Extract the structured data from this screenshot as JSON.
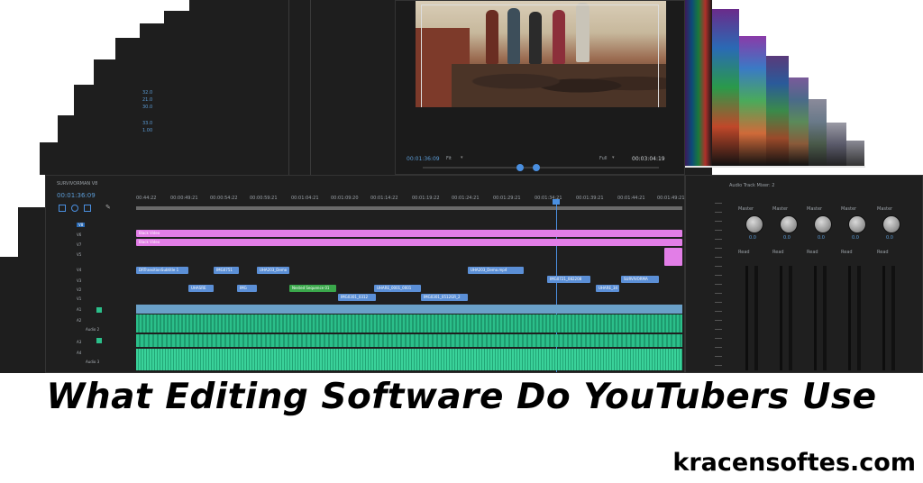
{
  "headline": "What Editing Software Do YouTubers Use",
  "site": "kracensoftes.com",
  "program_monitor": {
    "timecode_in": "00:01:36:09",
    "fit": "Fit",
    "quality": "Full",
    "timecode_out": "00:03:04:19"
  },
  "timeline": {
    "sequence_name": "SURVIVORMAN V8",
    "playhead_time": "00:01:36:09",
    "ruler": [
      "00:44:22",
      "00:00:49:21",
      "00:00:54:22",
      "00:00:59:21",
      "00:01:04:21",
      "00:01:09:20",
      "00:01:14:22",
      "00:01:19:22",
      "00:01:24:21",
      "00:01:29:21",
      "00:01:34:21",
      "00:01:39:21",
      "00:01:44:21",
      "00:01:49:21"
    ],
    "video_tracks": [
      "V8",
      "V6",
      "V7",
      "V5",
      "V4",
      "V3",
      "V2",
      "V1"
    ],
    "audio_tracks": [
      "A1",
      "A2",
      "A3",
      "A4"
    ],
    "audio_labels": [
      "Audio 2",
      "Audio 3"
    ],
    "clips": {
      "black_video_1": "Black Video",
      "black_video_2": "Black Video",
      "c1": "DRTransitionSubtitle 1",
      "c2": "IMG0751",
      "c3": "UHA203_Demo",
      "c4": "UHA203_Demo.mp4",
      "c5": "IMG0721_082208",
      "c6": "SURVIVORMA",
      "c7": "UHASRE",
      "c8": "IMG",
      "c9": "Nested Sequence 01",
      "c10": "UHARE_0001_0001",
      "c11": "IMG0301_0312",
      "c12": "IMG0301_0512GR_2",
      "c13": "UHARE_34"
    }
  },
  "audio_mixer": {
    "title": "Audio Track Mixer: 2",
    "channels": [
      {
        "label": "Master",
        "read": "Read",
        "value": "0.0"
      },
      {
        "label": "Master",
        "read": "Read",
        "value": "0.0"
      },
      {
        "label": "Master",
        "read": "Read",
        "value": "0.0"
      },
      {
        "label": "Master",
        "read": "Read",
        "value": "0.0"
      },
      {
        "label": "Master",
        "read": "Read",
        "value": "0.0"
      }
    ]
  },
  "left_panel_values": [
    "32.0",
    "21.0",
    "30.0",
    "33.0",
    "1.00"
  ],
  "colors": {
    "pink_clip": "#e27ee7",
    "video_clip": "#5b8fd6",
    "audio_clip": "#2bbf8a",
    "nested_clip": "#3aa84b",
    "ui_dark": "#232323"
  }
}
